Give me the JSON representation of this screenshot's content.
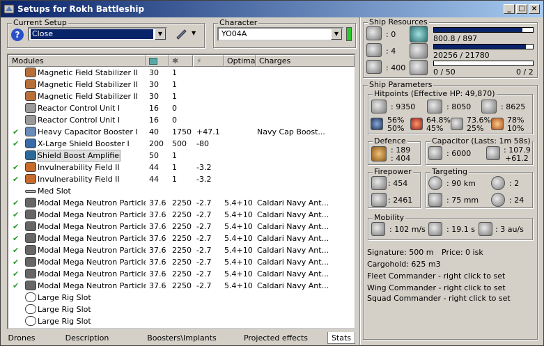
{
  "window": {
    "title": "Setups for Rokh Battleship",
    "buttons": {
      "minimize": "_",
      "maximize": "□",
      "close": "×"
    }
  },
  "current_setup": {
    "label": "Current Setup",
    "value": "Close"
  },
  "character": {
    "label": "Character",
    "value": "YO04A",
    "status_color": "#2ec42e"
  },
  "modules": {
    "columns": [
      "Modules",
      "",
      "",
      "",
      "Optimal",
      "Charges"
    ],
    "column_icons": [
      "cpu-icon",
      "powergrid-icon",
      "damage-icon"
    ],
    "rows": [
      {
        "check": false,
        "icon": "magnetic-field-stabilizer-icon",
        "name": "Magnetic Field Stabilizer II",
        "cpu": "30",
        "pg": "1",
        "dmg": "",
        "optimal": "",
        "charges": ""
      },
      {
        "check": false,
        "icon": "magnetic-field-stabilizer-icon",
        "name": "Magnetic Field Stabilizer II",
        "cpu": "30",
        "pg": "1",
        "dmg": "",
        "optimal": "",
        "charges": ""
      },
      {
        "check": false,
        "icon": "magnetic-field-stabilizer-icon",
        "name": "Magnetic Field Stabilizer II",
        "cpu": "30",
        "pg": "1",
        "dmg": "",
        "optimal": "",
        "charges": ""
      },
      {
        "check": false,
        "icon": "reactor-control-unit-icon",
        "name": "Reactor Control Unit I",
        "cpu": "16",
        "pg": "0",
        "dmg": "",
        "optimal": "",
        "charges": ""
      },
      {
        "check": false,
        "icon": "reactor-control-unit-icon",
        "name": "Reactor Control Unit I",
        "cpu": "16",
        "pg": "0",
        "dmg": "",
        "optimal": "",
        "charges": ""
      },
      {
        "check": true,
        "icon": "capacitor-booster-icon",
        "name": "Heavy Capacitor Booster I",
        "cpu": "40",
        "pg": "1750",
        "dmg": "+47.1",
        "optimal": "",
        "charges": "Navy Cap Boost..."
      },
      {
        "check": true,
        "icon": "shield-booster-icon",
        "name": "X-Large Shield Booster I",
        "cpu": "200",
        "pg": "500",
        "dmg": "-80",
        "optimal": "",
        "charges": ""
      },
      {
        "check": false,
        "icon": "shield-boost-amplifier-icon",
        "name": "Shield Boost Amplifier I",
        "cpu": "50",
        "pg": "1",
        "dmg": "",
        "optimal": "",
        "charges": "",
        "selected": true
      },
      {
        "check": true,
        "icon": "invulnerability-field-icon",
        "name": "Invulnerability Field II",
        "cpu": "44",
        "pg": "1",
        "dmg": "-3.2",
        "optimal": "",
        "charges": ""
      },
      {
        "check": true,
        "icon": "invulnerability-field-icon",
        "name": "Invulnerability Field II",
        "cpu": "44",
        "pg": "1",
        "dmg": "-3.2",
        "optimal": "",
        "charges": ""
      },
      {
        "check": false,
        "icon": "med-slot-icon",
        "name": "Med Slot",
        "cpu": "",
        "pg": "",
        "dmg": "",
        "optimal": "",
        "charges": ""
      },
      {
        "check": true,
        "icon": "particle-accelerator-icon",
        "name": "Modal Mega Neutron Particle ...",
        "cpu": "37.6",
        "pg": "2250",
        "dmg": "-2.7",
        "optimal": "5.4+10",
        "charges": "Caldari Navy Ant..."
      },
      {
        "check": true,
        "icon": "particle-accelerator-icon",
        "name": "Modal Mega Neutron Particle ...",
        "cpu": "37.6",
        "pg": "2250",
        "dmg": "-2.7",
        "optimal": "5.4+10",
        "charges": "Caldari Navy Ant..."
      },
      {
        "check": true,
        "icon": "particle-accelerator-icon",
        "name": "Modal Mega Neutron Particle ...",
        "cpu": "37.6",
        "pg": "2250",
        "dmg": "-2.7",
        "optimal": "5.4+10",
        "charges": "Caldari Navy Ant..."
      },
      {
        "check": true,
        "icon": "particle-accelerator-icon",
        "name": "Modal Mega Neutron Particle ...",
        "cpu": "37.6",
        "pg": "2250",
        "dmg": "-2.7",
        "optimal": "5.4+10",
        "charges": "Caldari Navy Ant..."
      },
      {
        "check": true,
        "icon": "particle-accelerator-icon",
        "name": "Modal Mega Neutron Particle ...",
        "cpu": "37.6",
        "pg": "2250",
        "dmg": "-2.7",
        "optimal": "5.4+10",
        "charges": "Caldari Navy Ant..."
      },
      {
        "check": true,
        "icon": "particle-accelerator-icon",
        "name": "Modal Mega Neutron Particle ...",
        "cpu": "37.6",
        "pg": "2250",
        "dmg": "-2.7",
        "optimal": "5.4+10",
        "charges": "Caldari Navy Ant..."
      },
      {
        "check": true,
        "icon": "particle-accelerator-icon",
        "name": "Modal Mega Neutron Particle ...",
        "cpu": "37.6",
        "pg": "2250",
        "dmg": "-2.7",
        "optimal": "5.4+10",
        "charges": "Caldari Navy Ant..."
      },
      {
        "check": true,
        "icon": "particle-accelerator-icon",
        "name": "Modal Mega Neutron Particle ...",
        "cpu": "37.6",
        "pg": "2250",
        "dmg": "-2.7",
        "optimal": "5.4+10",
        "charges": "Caldari Navy Ant..."
      },
      {
        "check": false,
        "icon": "rig-slot-icon",
        "name": "Large Rig Slot",
        "cpu": "",
        "pg": "",
        "dmg": "",
        "optimal": "",
        "charges": ""
      },
      {
        "check": false,
        "icon": "rig-slot-icon",
        "name": "Large Rig Slot",
        "cpu": "",
        "pg": "",
        "dmg": "",
        "optimal": "",
        "charges": ""
      },
      {
        "check": false,
        "icon": "rig-slot-icon",
        "name": "Large Rig Slot",
        "cpu": "",
        "pg": "",
        "dmg": "",
        "optimal": "",
        "charges": ""
      }
    ]
  },
  "tabs": [
    "Drones",
    "Description",
    "Boosters\\Implants",
    "Projected effects",
    "Stats"
  ],
  "active_tab": "Stats",
  "resources": {
    "label": "Ship Resources",
    "turret_slots": ": 0",
    "launcher_slots": ": 4",
    "drone_bandwidth": ": 400",
    "cpu": "800.8 / 897",
    "cpu_fraction": 0.893,
    "powergrid": "20256 / 21780",
    "powergrid_fraction": 0.93,
    "calibration": "0 / 50",
    "calibration_fraction": 0,
    "rig_count": "0 / 2"
  },
  "params": {
    "label": "Ship Parameters",
    "hitpoints": {
      "label": "Hitpoints (Effective HP: 49,870)",
      "shield": ": 9350",
      "armor": ": 8050",
      "structure": ": 8625",
      "resists": [
        {
          "icon": "em-resist-icon",
          "top": "56%",
          "bottom": "50%"
        },
        {
          "icon": "thermal-resist-icon",
          "top": "64.8%",
          "bottom": "45%"
        },
        {
          "icon": "kinetic-resist-icon",
          "top": "73.6%",
          "bottom": "25%"
        },
        {
          "icon": "explosive-resist-icon",
          "top": "78%",
          "bottom": "10%"
        }
      ]
    },
    "defence": {
      "label": "Defence",
      "top": ": 189",
      "bottom": ": 404"
    },
    "capacitor": {
      "label": "Capacitor (Lasts: 1m 58s)",
      "capacity": ": 6000",
      "top": ": 107.9",
      "bottom": "+61.2"
    },
    "firepower": {
      "label": "Firepower",
      "top": ": 454",
      "bottom": ": 2461"
    },
    "targeting": {
      "label": "Targeting",
      "range": ": 90 km",
      "targets": ": 2",
      "resolution": ": 75 mm",
      "sensor": ": 24"
    },
    "mobility": {
      "label": "Mobility",
      "speed": ": 102 m/s",
      "align": ": 19.1 s",
      "warp": ": 3 au/s"
    },
    "signature": "Signature: 500 m",
    "price": "Price: 0 isk",
    "cargohold": "Cargohold: 625 m3",
    "fleet_commander": "Fleet Commander - right click to set",
    "wing_commander": "Wing Commander - right click to set",
    "squad_commander": "Squad Commander - right click to set"
  }
}
